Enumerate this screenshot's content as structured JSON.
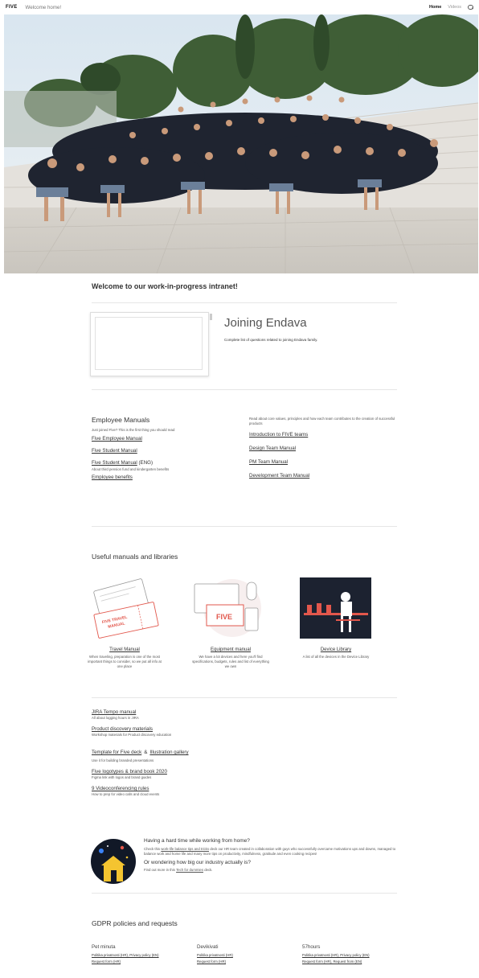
{
  "topbar": {
    "logo": "FIVE",
    "site_title": "Welcome home!",
    "nav": [
      "Home",
      "Videos"
    ],
    "active": "Home",
    "search_icon": "search-icon"
  },
  "hero": {
    "image": "team-photo"
  },
  "welcome": {
    "heading": "Welcome to our work-in-progress intranet!"
  },
  "joining": {
    "title": "Joining Endava",
    "description": "Complete list of questions related to joining Endava family."
  },
  "employee_manuals": {
    "title": "Employee Manuals",
    "intro": "Just joined Five? This is the first thing you should read",
    "links": [
      "Five Employee Manual",
      "Five Student Manual"
    ],
    "student_eng_link": "Five Student Manual",
    "student_eng_suffix": "(ENG)",
    "benefits_note": "About third pension fund and kindergarten benefits",
    "benefits_link": "Employee benefits"
  },
  "teams": {
    "intro": "Read about core values, principles and how each team contributes to the creation of successful products",
    "links": [
      "Introduction to FIVE teams",
      "Design Team Manual",
      "PM Team Manual",
      "Development Team Manual"
    ]
  },
  "useful": {
    "title": "Useful manuals and libraries",
    "cards": [
      {
        "link": "Travel Manual",
        "desc": "When traveling, preparation is one of the most important things to consider, so we put all info at one place",
        "art_text": "FIVE TRAVEL MANUAL"
      },
      {
        "link": "Equipment manual",
        "desc": "We have a lot devices and here you'll find specifications, budgets, rules and list of everything we own",
        "art_text": "FIVE"
      },
      {
        "link": "Device Library",
        "desc": "A list of all the devices in the Device Library"
      }
    ]
  },
  "links": [
    {
      "link": "JIRA Tempo manual",
      "desc": "All about logging hours in JIRA"
    },
    {
      "link": "Product discovery materials",
      "desc": "Workshop materials for Product discovery education"
    },
    {
      "link": "Template for Five deck",
      "amp": "&",
      "link2": "Illustration gallery",
      "desc": "Use it for building branded presentations"
    },
    {
      "link": "Five logotypes & brand book 2020",
      "desc": "Figma link with logos and brand guides"
    },
    {
      "link": "9 Videoconferencing rules",
      "desc": "How to prep for video calls and cloud events"
    }
  ],
  "wfh": {
    "q1": "Having a hard time while working from home?",
    "text_before": "Check this",
    "inline_link": "work-life balance tips and tricks",
    "text_after": "deck our HR team created in collaboration with guys who successfully overcame motivations ups and downs, managed to  balance work and home life and many more tips on productivity, mindfulness, gratitude and even cooking recipes!",
    "q2": "Or wondering how big our industry actually is?",
    "find_before": "Find out more in this",
    "find_link": "Tech for dummies",
    "find_after": "deck."
  },
  "gdpr": {
    "title": "GDPR policies and requests",
    "cols": [
      {
        "name": "Pet minuta",
        "line1": "Politika privatnosti (HR), Privacy policy (EN)",
        "line2": "Request form (HR)"
      },
      {
        "name": "Devikivati",
        "line1": "Politika privatnosti (HR)",
        "line2": "Request form (HR)"
      },
      {
        "name": "57hours",
        "line1": "Politika privatnosti (HR), Privacy policy (EN)",
        "line2": "Request form (HR), Request from (EN)"
      }
    ]
  },
  "colors": {
    "accent_red": "#e2574c",
    "dark_navy": "#1c2230",
    "divider": "#e6e6e6"
  }
}
